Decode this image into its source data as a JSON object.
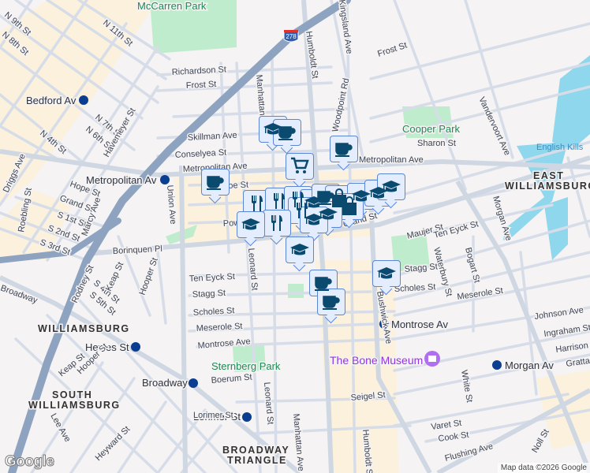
{
  "map": {
    "colors": {
      "land": "#f5f3f3",
      "road": "#d6dde8",
      "highway": "#8ea3c0",
      "park": "#bfeccd",
      "water": "#8fd7ec",
      "urban": "#fbf1dc",
      "marker_fill": "#e3edfd",
      "marker_icon": "#0b4a6f"
    },
    "highway_shield": "278",
    "parks": [
      "McCarren Park",
      "Cooper Park",
      "Sternberg Park"
    ],
    "water": [
      "English Kills"
    ],
    "neighborhoods": [
      "EAST",
      "WILLIAMSBURG",
      "WILLIAMSBURG",
      "SOUTH",
      "WILLIAMSBURG",
      "BROADWAY",
      "TRIANGLE"
    ],
    "stations": [
      "Bedford Av",
      "Metropolitan Av",
      "Hewes St",
      "Broadway",
      "Lorimer St",
      "Montrose Av",
      "Morgan Av"
    ],
    "poi": "The Bone Museum",
    "streets": [
      "N 9th St",
      "N 8th St",
      "N 11th St",
      "Richardson St",
      "Frost St",
      "Frost St",
      "N 7th St",
      "N 6th St",
      "N 4th St",
      "Havemeyer St",
      "Skillman Ave",
      "Conselyea St",
      "Metropolitan Ave",
      "Metropolitan Ave",
      "Devoe St",
      "Hope St",
      "Grand St",
      "S 1st St",
      "S 2nd St",
      "S 3rd St",
      "Driggs Ave",
      "Roebling St",
      "Marcy Ave",
      "Union Ave",
      "Manhattan Ave",
      "Humboldt St",
      "Woodpoint Rd",
      "Kingsland Ave",
      "Sharon St",
      "Vandervoort Ave",
      "Grand St",
      "Borinquen Pl",
      "Powers St",
      "Maujer St",
      "Ten Eyck St",
      "Ten Eyck St",
      "Morgan Ave",
      "Stagg St",
      "Stagg St",
      "Scholes St",
      "Scholes St",
      "Meserole St",
      "Meserole St",
      "Montrose Ave",
      "Boerum St",
      "Leonard St",
      "Leonard St",
      "Hooper St",
      "Hooper St",
      "Rodney St",
      "S 4th St",
      "S 5th St",
      "Keap St",
      "Keap St",
      "Broadway",
      "Lee Ave",
      "Heyward St",
      "Waterbury St",
      "Bogart St",
      "Johnson Ave",
      "Ingraham St",
      "Harrison Pl",
      "Grattan St",
      "White St",
      "Seigel St",
      "Varet St",
      "Cook St",
      "Flushing Ave",
      "Noll St",
      "Humboldt St",
      "Manhattan Ave",
      "Bushwick Ave",
      "Lorimer St"
    ],
    "markers": [
      "school",
      "coffee",
      "shopping-cart",
      "coffee",
      "coffee",
      "restaurant",
      "restaurant",
      "restaurant",
      "school",
      "coffee",
      "shopping-bag",
      "school",
      "school",
      "school",
      "restaurant",
      "shopping-bag",
      "school",
      "school",
      "restaurant",
      "school",
      "school",
      "coffee",
      "coffee",
      "school"
    ],
    "logo": "Google",
    "attribution": "Map data ©2026 Google"
  }
}
